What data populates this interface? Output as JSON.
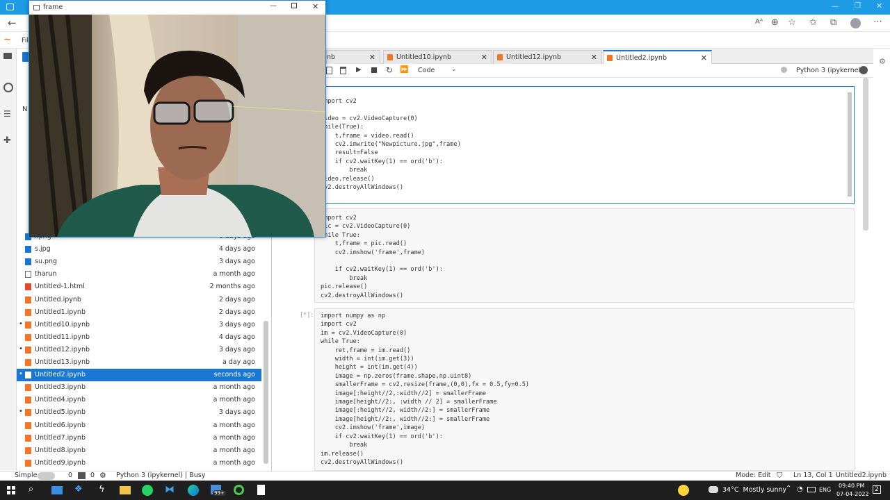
{
  "frame_window": {
    "title": "frame"
  },
  "jupyter": {
    "menu_first": "Fil",
    "file_browser": {
      "header": "N",
      "files": [
        {
          "name": "i.png",
          "modified": "6 days ago",
          "type": "image",
          "running": false
        },
        {
          "name": "s.jpg",
          "modified": "4 days ago",
          "type": "image",
          "running": false
        },
        {
          "name": "su.png",
          "modified": "3 days ago",
          "type": "image",
          "running": false
        },
        {
          "name": "tharun",
          "modified": "a month ago",
          "type": "file",
          "running": false
        },
        {
          "name": "Untitled-1.html",
          "modified": "2 months ago",
          "type": "html",
          "running": false
        },
        {
          "name": "Untitled.ipynb",
          "modified": "2 days ago",
          "type": "notebook",
          "running": false
        },
        {
          "name": "Untitled1.ipynb",
          "modified": "2 days ago",
          "type": "notebook",
          "running": false
        },
        {
          "name": "Untitled10.ipynb",
          "modified": "3 days ago",
          "type": "notebook",
          "running": true
        },
        {
          "name": "Untitled11.ipynb",
          "modified": "4 days ago",
          "type": "notebook",
          "running": false
        },
        {
          "name": "Untitled12.ipynb",
          "modified": "3 days ago",
          "type": "notebook",
          "running": true
        },
        {
          "name": "Untitled13.ipynb",
          "modified": "a day ago",
          "type": "notebook",
          "running": false
        },
        {
          "name": "Untitled2.ipynb",
          "modified": "seconds ago",
          "type": "notebook",
          "running": true,
          "selected": true
        },
        {
          "name": "Untitled3.ipynb",
          "modified": "a month ago",
          "type": "notebook",
          "running": false
        },
        {
          "name": "Untitled4.ipynb",
          "modified": "a month ago",
          "type": "notebook",
          "running": false
        },
        {
          "name": "Untitled5.ipynb",
          "modified": "3 days ago",
          "type": "notebook",
          "running": true
        },
        {
          "name": "Untitled6.ipynb",
          "modified": "a month ago",
          "type": "notebook",
          "running": false
        },
        {
          "name": "Untitled7.ipynb",
          "modified": "a month ago",
          "type": "notebook",
          "running": false
        },
        {
          "name": "Untitled8.ipynb",
          "modified": "a month ago",
          "type": "notebook",
          "running": false
        },
        {
          "name": "Untitled9.ipynb",
          "modified": "a month ago",
          "type": "notebook",
          "running": false
        }
      ]
    },
    "tabs": [
      {
        "label": "nb",
        "active": false
      },
      {
        "label": "Untitled10.ipynb",
        "active": false
      },
      {
        "label": "Untitled12.ipynb",
        "active": false
      },
      {
        "label": "Untitled2.ipynb",
        "active": true
      }
    ],
    "toolbar": {
      "cell_type": "Code",
      "kernel": "Python 3 (ipykernel)"
    },
    "cells": [
      {
        "prompt": "",
        "active": true,
        "code": "import cv2\n\nvideo = cv2.VideoCapture(0)\nwhile(True):\n    t,frame = video.read()\n    cv2.imwrite(\"Newpicture.jpg\",frame)\n    result=False\n    if cv2.waitKey(1) == ord('b'):\n        break\nvideo.release()\ncv2.destroyAllWindows()"
      },
      {
        "prompt": "",
        "active": false,
        "code": "import cv2\npic = cv2.VideoCapture(0)\nwhile True:\n    t,frame = pic.read()\n    cv2.imshow('frame',frame)\n\n    if cv2.waitKey(1) == ord('b'):\n        break\npic.release()\ncv2.destroyAllWindows()"
      },
      {
        "prompt": "[*]:",
        "active": false,
        "code": "import numpy as np\nimport cv2\nim = cv2.VideoCapture(0)\nwhile True:\n    ret,frame = im.read()\n    width = int(im.get(3))\n    height = int(im.get(4))\n    image = np.zeros(frame.shape,np.uint8)\n    smallerFrame = cv2.resize(frame,(0,0),fx = 0.5,fy=0.5)\n    image[:height//2,:width//2] = smallerFrame\n    image[height//2:, :width // 2] = smallerFrame\n    image[:height//2, width//2:] = smallerFrame\n    image[height//2:, width//2:] = smallerFrame\n    cv2.imshow('frame',image)\n    if cv2.waitKey(1) == ord('b'):\n        break\nim.release()\ncv2.destroyAllWindows()"
      }
    ],
    "statusbar": {
      "mode_label": "Simple",
      "count_a": "0",
      "count_b": "0",
      "kernel_status": "Python 3 (ipykernel) | Busy",
      "mode": "Mode: Edit",
      "position": "Ln 13, Col 1",
      "file": "Untitled2.ipynb"
    }
  },
  "taskbar": {
    "badge": "99+",
    "weather": "34°C  Mostly sunny",
    "lang": "ENG",
    "time": "09:40 PM",
    "date": "07-04-2022",
    "notif": "2"
  }
}
